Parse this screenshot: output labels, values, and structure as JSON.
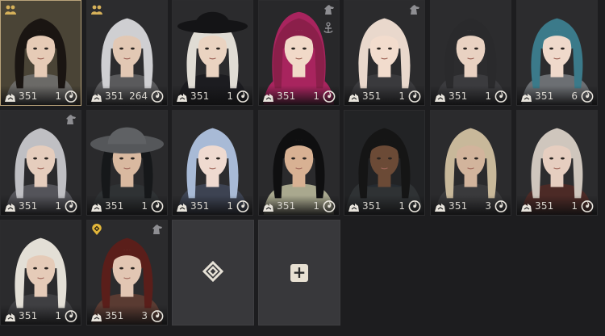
{
  "characters": [
    {
      "level": "351",
      "count": "1",
      "badge_left": "family-icon",
      "badge_right": "",
      "selected": true,
      "hair": "#1a1512",
      "skin": "#e6cbb6",
      "cloth": "#6b6a67",
      "bg": "#4a4436"
    },
    {
      "level": "351",
      "count": "264",
      "badge_left": "family-icon",
      "badge_right": "",
      "hair": "#cfcfd2",
      "skin": "#e2c8b4",
      "cloth": "#5a5a5c",
      "bg": "#2c2c2e"
    },
    {
      "level": "351",
      "count": "1",
      "badge_left": "",
      "badge_right": "",
      "hat": true,
      "hair": "#e0dcd4",
      "skin": "#ead3c1",
      "cloth": "#1c1c20",
      "bg": "#2b2b2d"
    },
    {
      "level": "351",
      "count": "1",
      "badge_left": "",
      "badge_right": "horse-icon",
      "badge_right2": "anchor-icon",
      "hair": "#8b1f4a",
      "skin": "#f1d9c8",
      "cloth": "#a8245e",
      "bg": "#28282a",
      "hood": true
    },
    {
      "level": "351",
      "count": "1",
      "badge_left": "",
      "badge_right": "horse-icon",
      "hair": "#e9d8cc",
      "skin": "#f2dccd",
      "cloth": "#3a3a3d",
      "bg": "#2b2b2d"
    },
    {
      "level": "351",
      "count": "1",
      "badge_left": "",
      "badge_right": "",
      "hair": "#2a2a2c",
      "skin": "#e9d2c2",
      "cloth": "#3b3b3e",
      "bg": "#2c2c2e"
    },
    {
      "level": "351",
      "count": "6",
      "badge_left": "",
      "badge_right": "",
      "hair": "#3b7a8a",
      "skin": "#efd9cb",
      "cloth": "#6c6f73",
      "bg": "#2c2c2e"
    },
    {
      "level": "351",
      "count": "1",
      "badge_left": "",
      "badge_right": "horse-icon",
      "hair": "#bfbfc3",
      "skin": "#e5cdbd",
      "cloth": "#54545a",
      "bg": "#2b2b2d"
    },
    {
      "level": "351",
      "count": "1",
      "badge_left": "",
      "badge_right": "",
      "hat": "wide",
      "hair": "#16181a",
      "skin": "#d9b9a0",
      "cloth": "#2f3234",
      "bg": "#2a2a2c"
    },
    {
      "level": "351",
      "count": "1",
      "badge_left": "",
      "badge_right": "",
      "hair": "#a8bad6",
      "skin": "#efdad0",
      "cloth": "#3d4352",
      "bg": "#2c2c2e"
    },
    {
      "level": "351",
      "count": "1",
      "badge_left": "",
      "badge_right": "",
      "hair": "#0f0f10",
      "skin": "#d8b193",
      "cloth": "#a9a88e",
      "bg": "#2a2a2c"
    },
    {
      "level": "351",
      "count": "1",
      "badge_left": "",
      "badge_right": "",
      "hair": "#151515",
      "skin": "#6b4a36",
      "cloth": "#252a30",
      "bg": "#222325",
      "fur": true
    },
    {
      "level": "351",
      "count": "3",
      "badge_left": "",
      "badge_right": "",
      "hair": "#c8b89a",
      "skin": "#d2b49c",
      "cloth": "#3a3a3c",
      "bg": "#2b2b2d"
    },
    {
      "level": "351",
      "count": "1",
      "badge_left": "",
      "badge_right": "",
      "hair": "#cfc6bd",
      "skin": "#e6cec0",
      "cloth": "#4c2a26",
      "bg": "#2c2c2e"
    },
    {
      "level": "351",
      "count": "1",
      "badge_left": "",
      "badge_right": "",
      "hair": "#e3dfd6",
      "skin": "#e5cbb8",
      "cloth": "#3f3f42",
      "bg": "#2b2b2d"
    },
    {
      "level": "351",
      "count": "3",
      "badge_left": "location-icon",
      "badge_right": "horse-icon",
      "hair": "#5a1e1a",
      "skin": "#e2c6b3",
      "cloth": "#5a3b32",
      "bg": "#2b2b2d"
    }
  ],
  "empty_slots": [
    {
      "icon": "character-slot-icon"
    },
    {
      "icon": "add-icon",
      "label": "+"
    }
  ],
  "colors": {
    "background": "#1d1d1f",
    "selected_border": "#b8a27a",
    "text": "#d9d6cf"
  }
}
